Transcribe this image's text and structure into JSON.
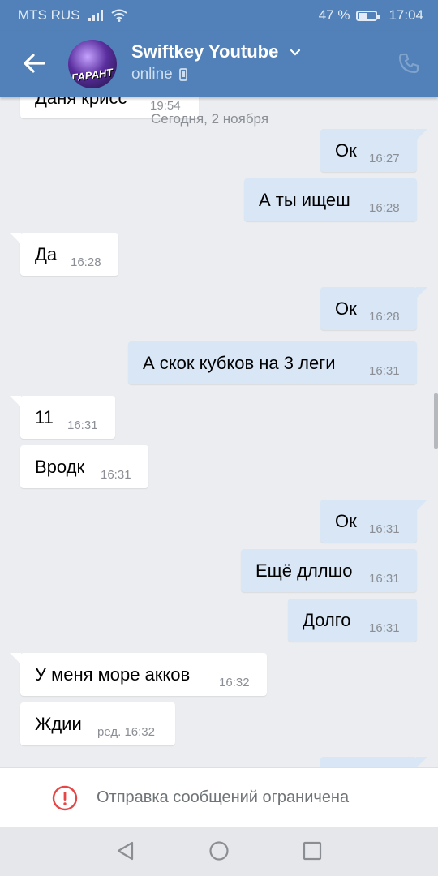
{
  "status_bar": {
    "carrier": "MTS RUS",
    "battery": "47 %",
    "battery_level": 0.47,
    "time": "17:04"
  },
  "header": {
    "title": "Swiftkey Youtube",
    "status": "online",
    "avatar_text": "ГАРАНТ",
    "accent": "#5181b8"
  },
  "chat": {
    "partial_top": {
      "text": "Даня крисс",
      "time": "19:54"
    },
    "date_separator": "Сегодня, 2 ноября",
    "messages": [
      {
        "dir": "out",
        "text": "Ок",
        "time": "16:27"
      },
      {
        "dir": "out",
        "text": "А ты ищеш",
        "time": "16:28"
      },
      {
        "dir": "in",
        "text": "Да",
        "time": "16:28"
      },
      {
        "dir": "out",
        "text": "Ок",
        "time": "16:28"
      },
      {
        "dir": "out",
        "text": "А скок кубков на 3 леги",
        "time": "16:31"
      },
      {
        "dir": "in",
        "text": "11",
        "time": "16:31"
      },
      {
        "dir": "in",
        "text": "Вродк",
        "time": "16:31"
      },
      {
        "dir": "out",
        "text": "Ок",
        "time": "16:31"
      },
      {
        "dir": "out",
        "text": "Ещё дллшо",
        "time": "16:31"
      },
      {
        "dir": "out",
        "text": "Долго",
        "time": "16:31"
      },
      {
        "dir": "in",
        "text": "У меня море акков",
        "time": "16:32"
      },
      {
        "dir": "in",
        "text": "Ждии",
        "time": "ред. 16:32"
      }
    ]
  },
  "footer": {
    "notice": "Отправка сообщений ограничена",
    "notice_icon": "exclamation-circle-icon",
    "warning_color": "#e64646"
  },
  "nav": {
    "back_icon": "triangle-back-icon",
    "home_icon": "circle-home-icon",
    "recents_icon": "square-recents-icon"
  }
}
